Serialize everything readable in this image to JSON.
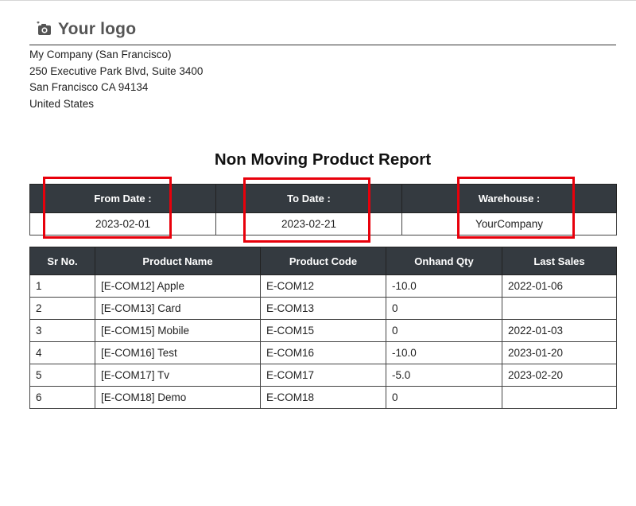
{
  "header": {
    "logo_text": "Your logo",
    "logo_icon": "camera-icon"
  },
  "company": {
    "name": "My Company (San Francisco)",
    "street": "250 Executive Park Blvd, Suite 3400",
    "city": "San Francisco CA 94134",
    "country": "United States"
  },
  "report": {
    "title": "Non Moving Product Report",
    "filters": {
      "from_label": "From Date :",
      "from_value": "2023-02-01",
      "to_label": "To Date :",
      "to_value": "2023-02-21",
      "warehouse_label": "Warehouse :",
      "warehouse_value": "YourCompany"
    },
    "columns": [
      "Sr No.",
      "Product Name",
      "Product Code",
      "Onhand Qty",
      "Last Sales"
    ],
    "rows": [
      [
        "1",
        "[E-COM12] Apple",
        "E-COM12",
        "-10.0",
        "2022-01-06"
      ],
      [
        "2",
        "[E-COM13] Card",
        "E-COM13",
        "0",
        ""
      ],
      [
        "3",
        "[E-COM15] Mobile",
        "E-COM15",
        "0",
        "2022-01-03"
      ],
      [
        "4",
        "[E-COM16] Test",
        "E-COM16",
        "-10.0",
        "2023-01-20"
      ],
      [
        "5",
        "[E-COM17] Tv",
        "E-COM17",
        "-5.0",
        "2023-02-20"
      ],
      [
        "6",
        "[E-COM18] Demo",
        "E-COM18",
        "0",
        ""
      ]
    ]
  },
  "highlight_color": "#e8000b"
}
